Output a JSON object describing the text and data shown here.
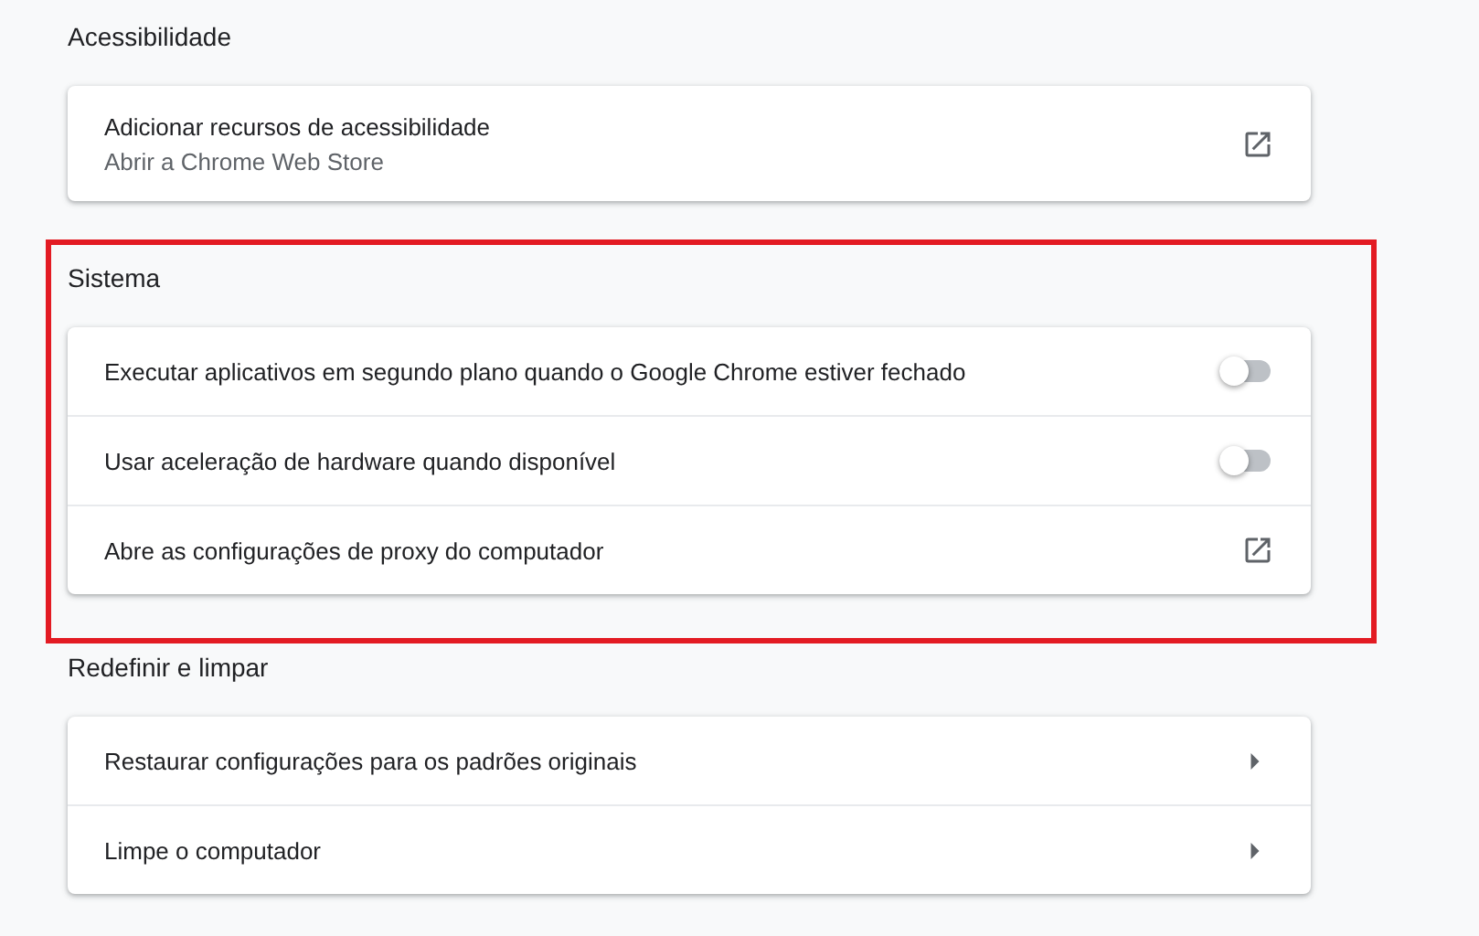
{
  "sections": [
    {
      "title": "Acessibilidade",
      "highlighted": false,
      "rows": [
        {
          "kind": "link",
          "label": "Adicionar recursos de acessibilidade",
          "sublabel": "Abrir a Chrome Web Store"
        }
      ]
    },
    {
      "title": "Sistema",
      "highlighted": true,
      "rows": [
        {
          "kind": "toggle",
          "label": "Executar aplicativos em segundo plano quando o Google Chrome estiver fechado",
          "on": false
        },
        {
          "kind": "toggle",
          "label": "Usar aceleração de hardware quando disponível",
          "on": false
        },
        {
          "kind": "link",
          "label": "Abre as configurações de proxy do computador"
        }
      ]
    },
    {
      "title": "Redefinir e limpar",
      "highlighted": false,
      "rows": [
        {
          "kind": "arrow",
          "label": "Restaurar configurações para os padrões originais"
        },
        {
          "kind": "arrow",
          "label": "Limpe o computador"
        }
      ]
    }
  ]
}
